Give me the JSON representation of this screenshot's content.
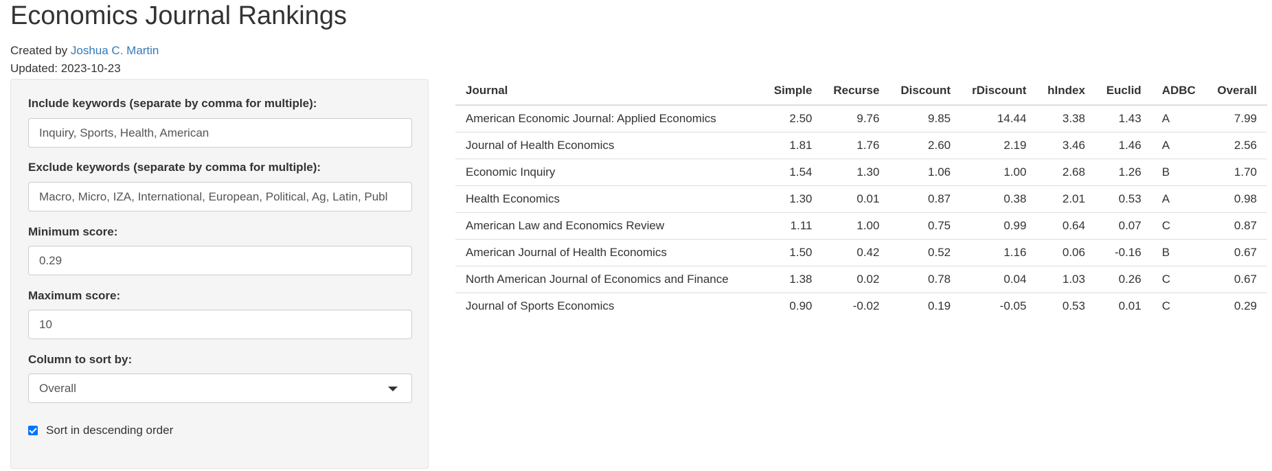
{
  "header": {
    "title": "Economics Journal Rankings",
    "created_prefix": "Created by ",
    "author": "Joshua C. Martin",
    "updated": "Updated: 2023-10-23"
  },
  "sidebar": {
    "include_label": "Include keywords (separate by comma for multiple):",
    "include_value": "Inquiry, Sports, Health, American",
    "exclude_label": "Exclude keywords (separate by comma for multiple):",
    "exclude_value": "Macro, Micro, IZA, International, European, Political, Ag, Latin, Publ",
    "min_label": "Minimum score:",
    "min_value": "0.29",
    "max_label": "Maximum score:",
    "max_value": "10",
    "sort_label": "Column to sort by:",
    "sort_value": "Overall",
    "desc_label": "Sort in descending order",
    "desc_checked": true
  },
  "table": {
    "columns": [
      "Journal",
      "Simple",
      "Recurse",
      "Discount",
      "rDiscount",
      "hIndex",
      "Euclid",
      "ADBC",
      "Overall"
    ],
    "rows": [
      [
        "American Economic Journal: Applied Economics",
        "2.50",
        "9.76",
        "9.85",
        "14.44",
        "3.38",
        "1.43",
        "A",
        "7.99"
      ],
      [
        "Journal of Health Economics",
        "1.81",
        "1.76",
        "2.60",
        "2.19",
        "3.46",
        "1.46",
        "A",
        "2.56"
      ],
      [
        "Economic Inquiry",
        "1.54",
        "1.30",
        "1.06",
        "1.00",
        "2.68",
        "1.26",
        "B",
        "1.70"
      ],
      [
        "Health Economics",
        "1.30",
        "0.01",
        "0.87",
        "0.38",
        "2.01",
        "0.53",
        "A",
        "0.98"
      ],
      [
        "American Law and Economics Review",
        "1.11",
        "1.00",
        "0.75",
        "0.99",
        "0.64",
        "0.07",
        "C",
        "0.87"
      ],
      [
        "American Journal of Health Economics",
        "1.50",
        "0.42",
        "0.52",
        "1.16",
        "0.06",
        "-0.16",
        "B",
        "0.67"
      ],
      [
        "North American Journal of Economics and Finance",
        "1.38",
        "0.02",
        "0.78",
        "0.04",
        "1.03",
        "0.26",
        "C",
        "0.67"
      ],
      [
        "Journal of Sports Economics",
        "0.90",
        "-0.02",
        "0.19",
        "-0.05",
        "0.53",
        "0.01",
        "C",
        "0.29"
      ]
    ]
  }
}
